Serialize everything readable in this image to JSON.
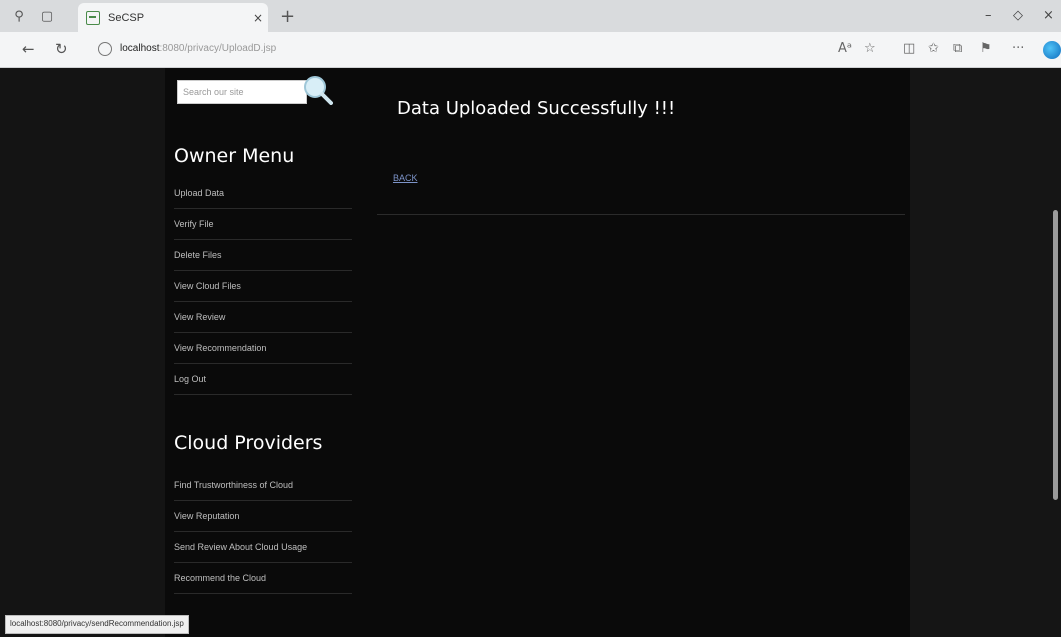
{
  "browser": {
    "tab_title": "SeCSP",
    "tab_close": "×",
    "new_tab": "+",
    "address": {
      "host": "localhost",
      "path": ":8080/privacy/UploadD.jsp"
    },
    "window_controls": {
      "minimize": "–",
      "maximize": "◇",
      "close": "×"
    }
  },
  "sidebar": {
    "search_placeholder": "Search our site",
    "owner_menu": {
      "title": "Owner Menu",
      "items": [
        {
          "label": "Upload Data"
        },
        {
          "label": "Verify File"
        },
        {
          "label": "Delete Files"
        },
        {
          "label": "View Cloud Files"
        },
        {
          "label": "View Review"
        },
        {
          "label": "View Recommendation"
        },
        {
          "label": "Log Out"
        }
      ]
    },
    "cloud_providers": {
      "title": "Cloud Providers",
      "items": [
        {
          "label": "Find Trustworthiness of Cloud"
        },
        {
          "label": "View Reputation"
        },
        {
          "label": "Send Review About Cloud Usage"
        },
        {
          "label": "Recommend the Cloud"
        }
      ]
    }
  },
  "main": {
    "title": "Data Uploaded Successfully !!!",
    "back_link": "BACK"
  },
  "status_bar": "localhost:8080/privacy/sendRecommendation.jsp"
}
